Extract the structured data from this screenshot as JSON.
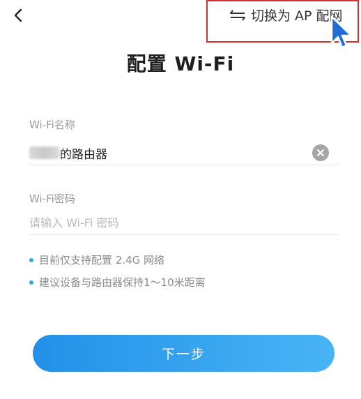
{
  "header": {
    "back_icon": "chevron-left-icon",
    "switch_icon": "swap-arrows-icon",
    "switch_label": "切换为 AP 配网"
  },
  "title": "配置 Wi-Fi",
  "ssid": {
    "label": "Wi-Fi名称",
    "value_suffix": "的路由器",
    "clear_icon": "clear-icon"
  },
  "password": {
    "label": "Wi-Fi密码",
    "placeholder": "请输入 Wi-Fi 密码",
    "value": ""
  },
  "tips": [
    "目前仅支持配置 2.4G 网络",
    "建议设备与路由器保持1～10米距离"
  ],
  "next_button": {
    "label": "下一步"
  },
  "colors": {
    "accent": "#2a9cef",
    "highlight_border": "#d3302f",
    "tip_dot": "#36a3e8"
  }
}
